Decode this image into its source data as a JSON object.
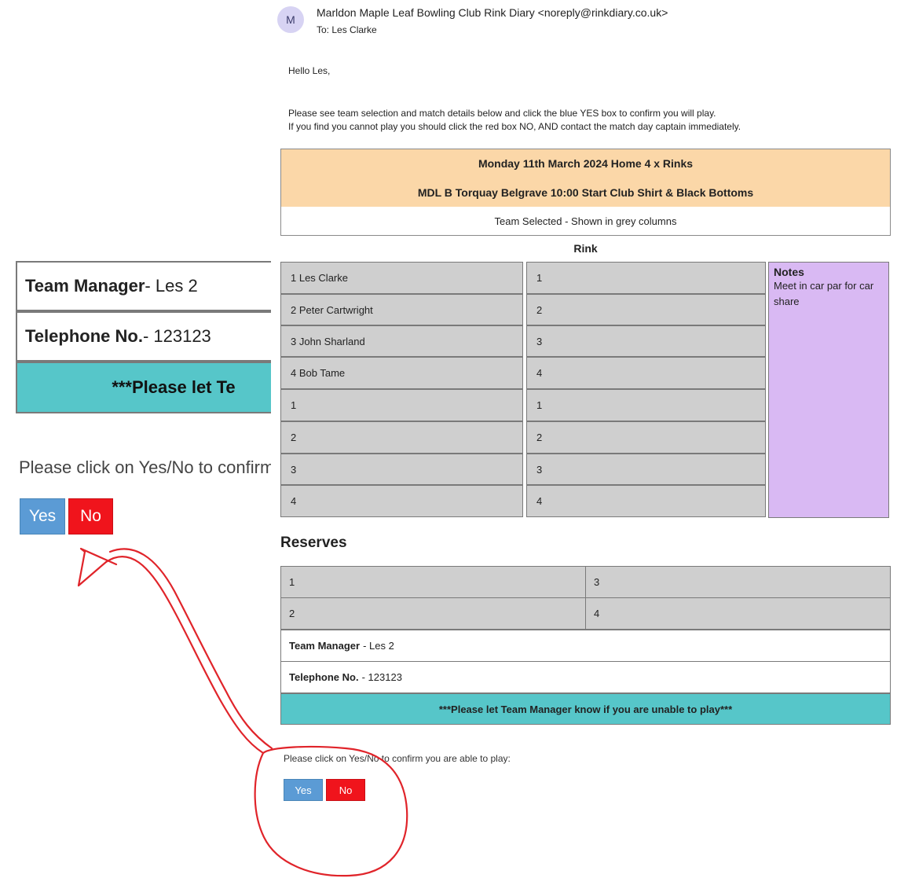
{
  "zoom": {
    "manager_label": "Team Manager",
    "manager_value": " - Les 2",
    "phone_label": "Telephone No.",
    "phone_value": " - 123123",
    "banner_partial": "***Please let Te",
    "prompt_partial": "Please click on Yes/No to confirm you are a",
    "yes_label": "Yes",
    "no_label": "No"
  },
  "email": {
    "avatar_initial": "M",
    "from": "Marldon Maple Leaf Bowling Club Rink Diary <noreply@rinkdiary.co.uk>",
    "to": "To:  Les Clarke",
    "greeting": "Hello Les,",
    "instruction_1": "Please see team selection and match details below and click the blue YES box to confirm you will play.",
    "instruction_2": "If you find you cannot play you should click the red box NO, AND contact the match day captain immediately.",
    "match_date": "Monday 11th March 2024 Home 4 x Rinks",
    "match_details": "MDL B Torquay Belgrave 10:00 Start Club Shirt & Black Bottoms",
    "team_selected": "Team Selected - Shown in grey columns",
    "rink_title": "Rink",
    "rink_left": [
      "1 Les Clarke",
      "2 Peter Cartwright",
      "3 John Sharland",
      "4 Bob Tame",
      "1",
      "2",
      "3",
      "4"
    ],
    "rink_right": [
      "1",
      "2",
      "3",
      "4",
      "1",
      "2",
      "3",
      "4"
    ],
    "notes_title": "Notes",
    "notes_text": "Meet in car par for car share",
    "reserves_title": "Reserves",
    "reserves": [
      [
        "1",
        "3"
      ],
      [
        "2",
        "4"
      ]
    ],
    "manager_label": "Team Manager",
    "manager_value": "- Les 2",
    "phone_label": "Telephone No.",
    "phone_value": "- 123123",
    "banner": "***Please let Team Manager know if you are unable to play***",
    "confirm_prompt": "Please click on Yes/No to confirm you are able to play:",
    "yes_label": "Yes",
    "no_label": "No"
  },
  "annotation_color": "#e0242a"
}
